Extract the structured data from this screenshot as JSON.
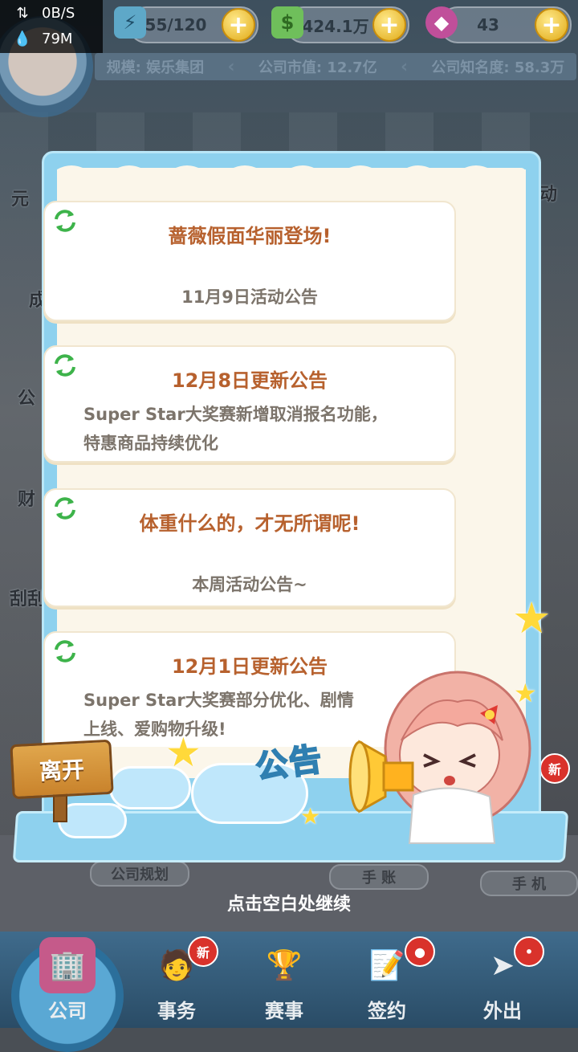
{
  "status": {
    "net_speed": "0B/S",
    "memory": "79M"
  },
  "resources": [
    {
      "name": "energy",
      "value": "55/120",
      "icon": "energy-icon"
    },
    {
      "name": "cash",
      "value": "1424.1万",
      "icon": "cash-icon"
    },
    {
      "name": "gem",
      "value": "43",
      "icon": "gem-icon"
    }
  ],
  "company": {
    "scale": "规模: 娱乐集团",
    "market_value": "公司市值: 12.7亿",
    "fame": "公司知名度: 58.3万"
  },
  "side_labels": [
    "元",
    "成",
    "公",
    "财",
    "刮刮"
  ],
  "right_labels": [
    "动"
  ],
  "notices": [
    {
      "title": "蔷薇假面华丽登场!",
      "sub": "11月9日活动公告"
    },
    {
      "title": "12月8日更新公告",
      "desc_line1": "Super Star大奖赛新增取消报名功能，",
      "desc_line2": "特惠商品持续优化"
    },
    {
      "title": "体重什么的，才无所谓呢!",
      "sub": "本周活动公告~"
    },
    {
      "title": "12月1日更新公告",
      "desc_line1": "Super Star大奖赛部分优化、剧情",
      "desc_line2": "上线、爱购物升级!"
    }
  ],
  "popup": {
    "exit_label": "离开",
    "notice_tag": "公告"
  },
  "sub_tags": {
    "plan": "公司规划",
    "ledger": "手 账",
    "phone": "手 机",
    "new_right": "新"
  },
  "continue_hint": "点击空白处继续",
  "nav": [
    {
      "label": "公司"
    },
    {
      "label": "事务",
      "badge": "新"
    },
    {
      "label": "赛事"
    },
    {
      "label": "签约"
    },
    {
      "label": "外出"
    }
  ]
}
